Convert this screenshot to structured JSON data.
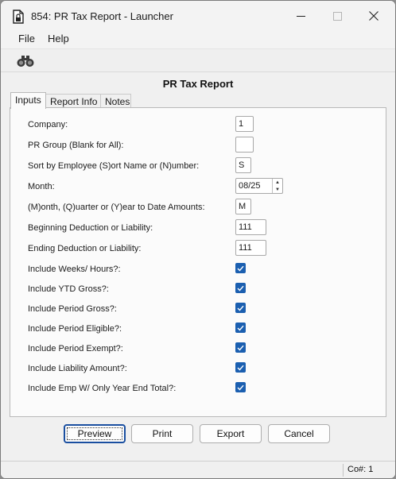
{
  "window": {
    "title": "854: PR Tax Report - Launcher"
  },
  "menu": {
    "items": [
      "File",
      "Help"
    ]
  },
  "report_title": "PR Tax Report",
  "tabs": [
    {
      "label": "Inputs",
      "active": true
    },
    {
      "label": "Report Info",
      "active": false
    },
    {
      "label": "Notes",
      "active": false
    }
  ],
  "form": {
    "company": {
      "label": "Company:",
      "value": "1"
    },
    "pr_group": {
      "label": "PR Group (Blank for All):",
      "value": ""
    },
    "sort_by": {
      "label": "Sort by Employee (S)ort Name or (N)umber:",
      "value": "S"
    },
    "month": {
      "label": "Month:",
      "value": "08/25"
    },
    "mqy": {
      "label": "(M)onth, (Q)uarter or (Y)ear to Date Amounts:",
      "value": "M"
    },
    "beg_ded": {
      "label": "Beginning Deduction or Liability:",
      "value": "111"
    },
    "end_ded": {
      "label": "Ending Deduction or Liability:",
      "value": "111"
    },
    "checkboxes": [
      {
        "label": "Include Weeks/ Hours?:",
        "checked": true
      },
      {
        "label": "Include YTD Gross?:",
        "checked": true
      },
      {
        "label": "Include Period Gross?:",
        "checked": true
      },
      {
        "label": "Include Period Eligible?:",
        "checked": true
      },
      {
        "label": "Include Period Exempt?:",
        "checked": true
      },
      {
        "label": "Include Liability Amount?:",
        "checked": true
      },
      {
        "label": "Include Emp W/ Only Year End Total?:",
        "checked": true
      }
    ]
  },
  "buttons": {
    "preview": "Preview",
    "print": "Print",
    "export": "Export",
    "cancel": "Cancel"
  },
  "status": {
    "company": "Co#: 1"
  },
  "colors": {
    "accent": "#1b5fb0",
    "background": "#f0f0f0",
    "panel": "#fbfbfb"
  },
  "icons": {
    "app": "document-lock-icon",
    "toolbar_find": "binoculars-icon"
  }
}
